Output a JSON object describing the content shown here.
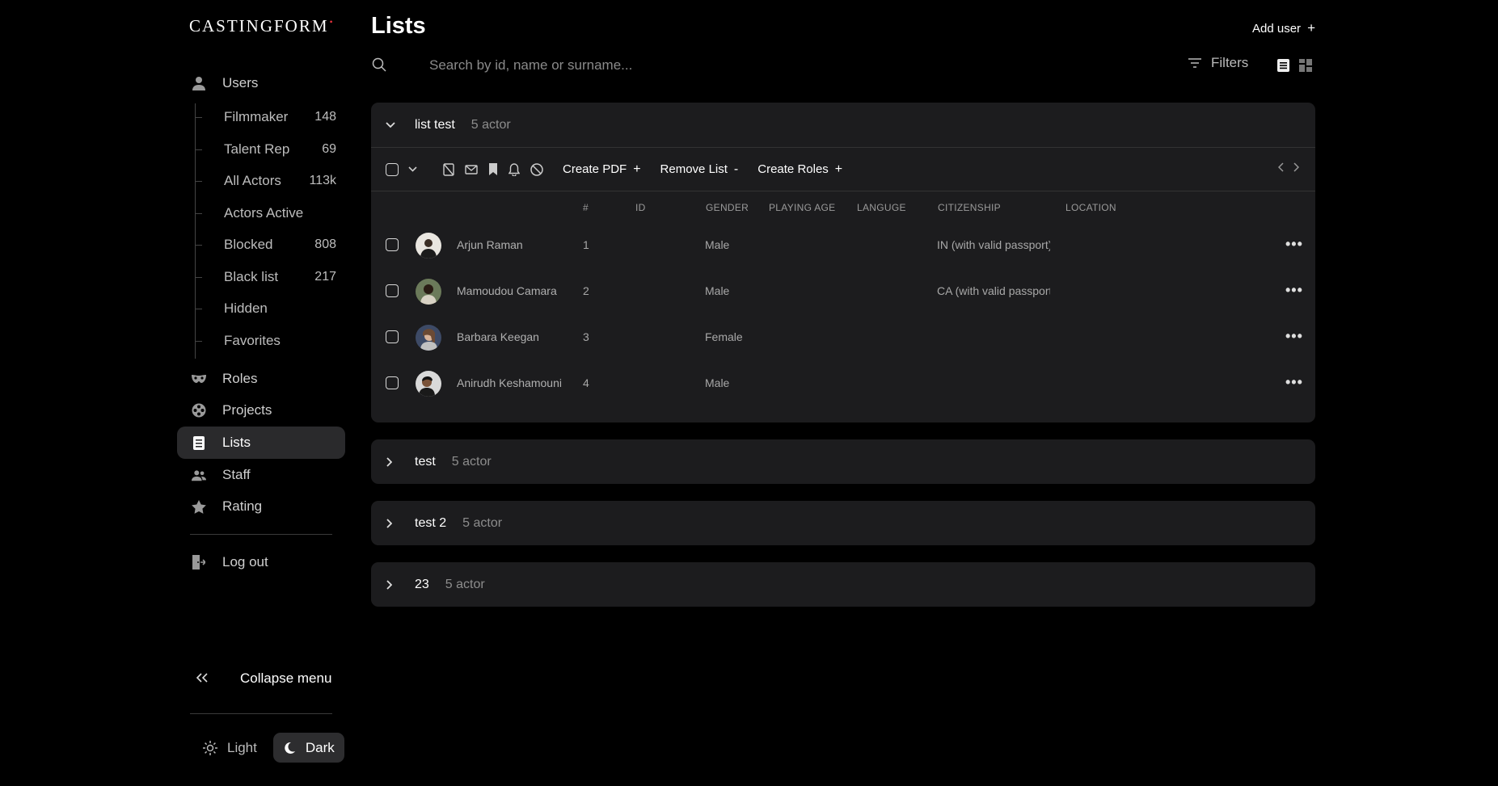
{
  "app": {
    "logo": "CASTINGFORM",
    "logo_mark": "•"
  },
  "sidebar": {
    "users": "Users",
    "sub_items": [
      {
        "label": "Filmmaker",
        "count": "148"
      },
      {
        "label": "Talent Rep",
        "count": "69"
      },
      {
        "label": "All Actors",
        "count": "113k"
      },
      {
        "label": "Actors Active",
        "count": ""
      },
      {
        "label": "Blocked",
        "count": "808"
      },
      {
        "label": "Black list",
        "count": "217"
      },
      {
        "label": "Hidden",
        "count": ""
      },
      {
        "label": "Favorites",
        "count": ""
      }
    ],
    "roles": "Roles",
    "projects": "Projects",
    "lists": "Lists",
    "staff": "Staff",
    "rating": "Rating",
    "logout": "Log out",
    "collapse": "Collapse menu",
    "theme_light": "Light",
    "theme_dark": "Dark"
  },
  "header": {
    "title": "Lists",
    "add_user": "Add user",
    "search_placeholder": "Search by id, name or surname...",
    "filters": "Filters"
  },
  "toolbar": {
    "create_pdf": "Create PDF",
    "remove_list": "Remove List",
    "create_roles": "Create Roles"
  },
  "table": {
    "columns": [
      "#",
      "ID",
      "GENDER",
      "PLAYING AGE",
      "LANGUGE",
      "CITIZENSHIP",
      "LOCATION"
    ],
    "rows": [
      {
        "name": "Arjun Raman",
        "num": "1",
        "gender": "Male",
        "citizenship": "IN (with valid passport)"
      },
      {
        "name": "Mamoudou Camara",
        "num": "2",
        "gender": "Male",
        "citizenship": "CA (with valid passport)"
      },
      {
        "name": "Barbara Keegan",
        "num": "3",
        "gender": "Female",
        "citizenship": ""
      },
      {
        "name": "Anirudh Keshamouni",
        "num": "4",
        "gender": "Male",
        "citizenship": ""
      }
    ]
  },
  "lists": [
    {
      "name": "list test",
      "count": "5 actor"
    },
    {
      "name": "test",
      "count": "5 actor"
    },
    {
      "name": "test 2",
      "count": "5 actor"
    },
    {
      "name": "23",
      "count": "5 actor"
    }
  ]
}
